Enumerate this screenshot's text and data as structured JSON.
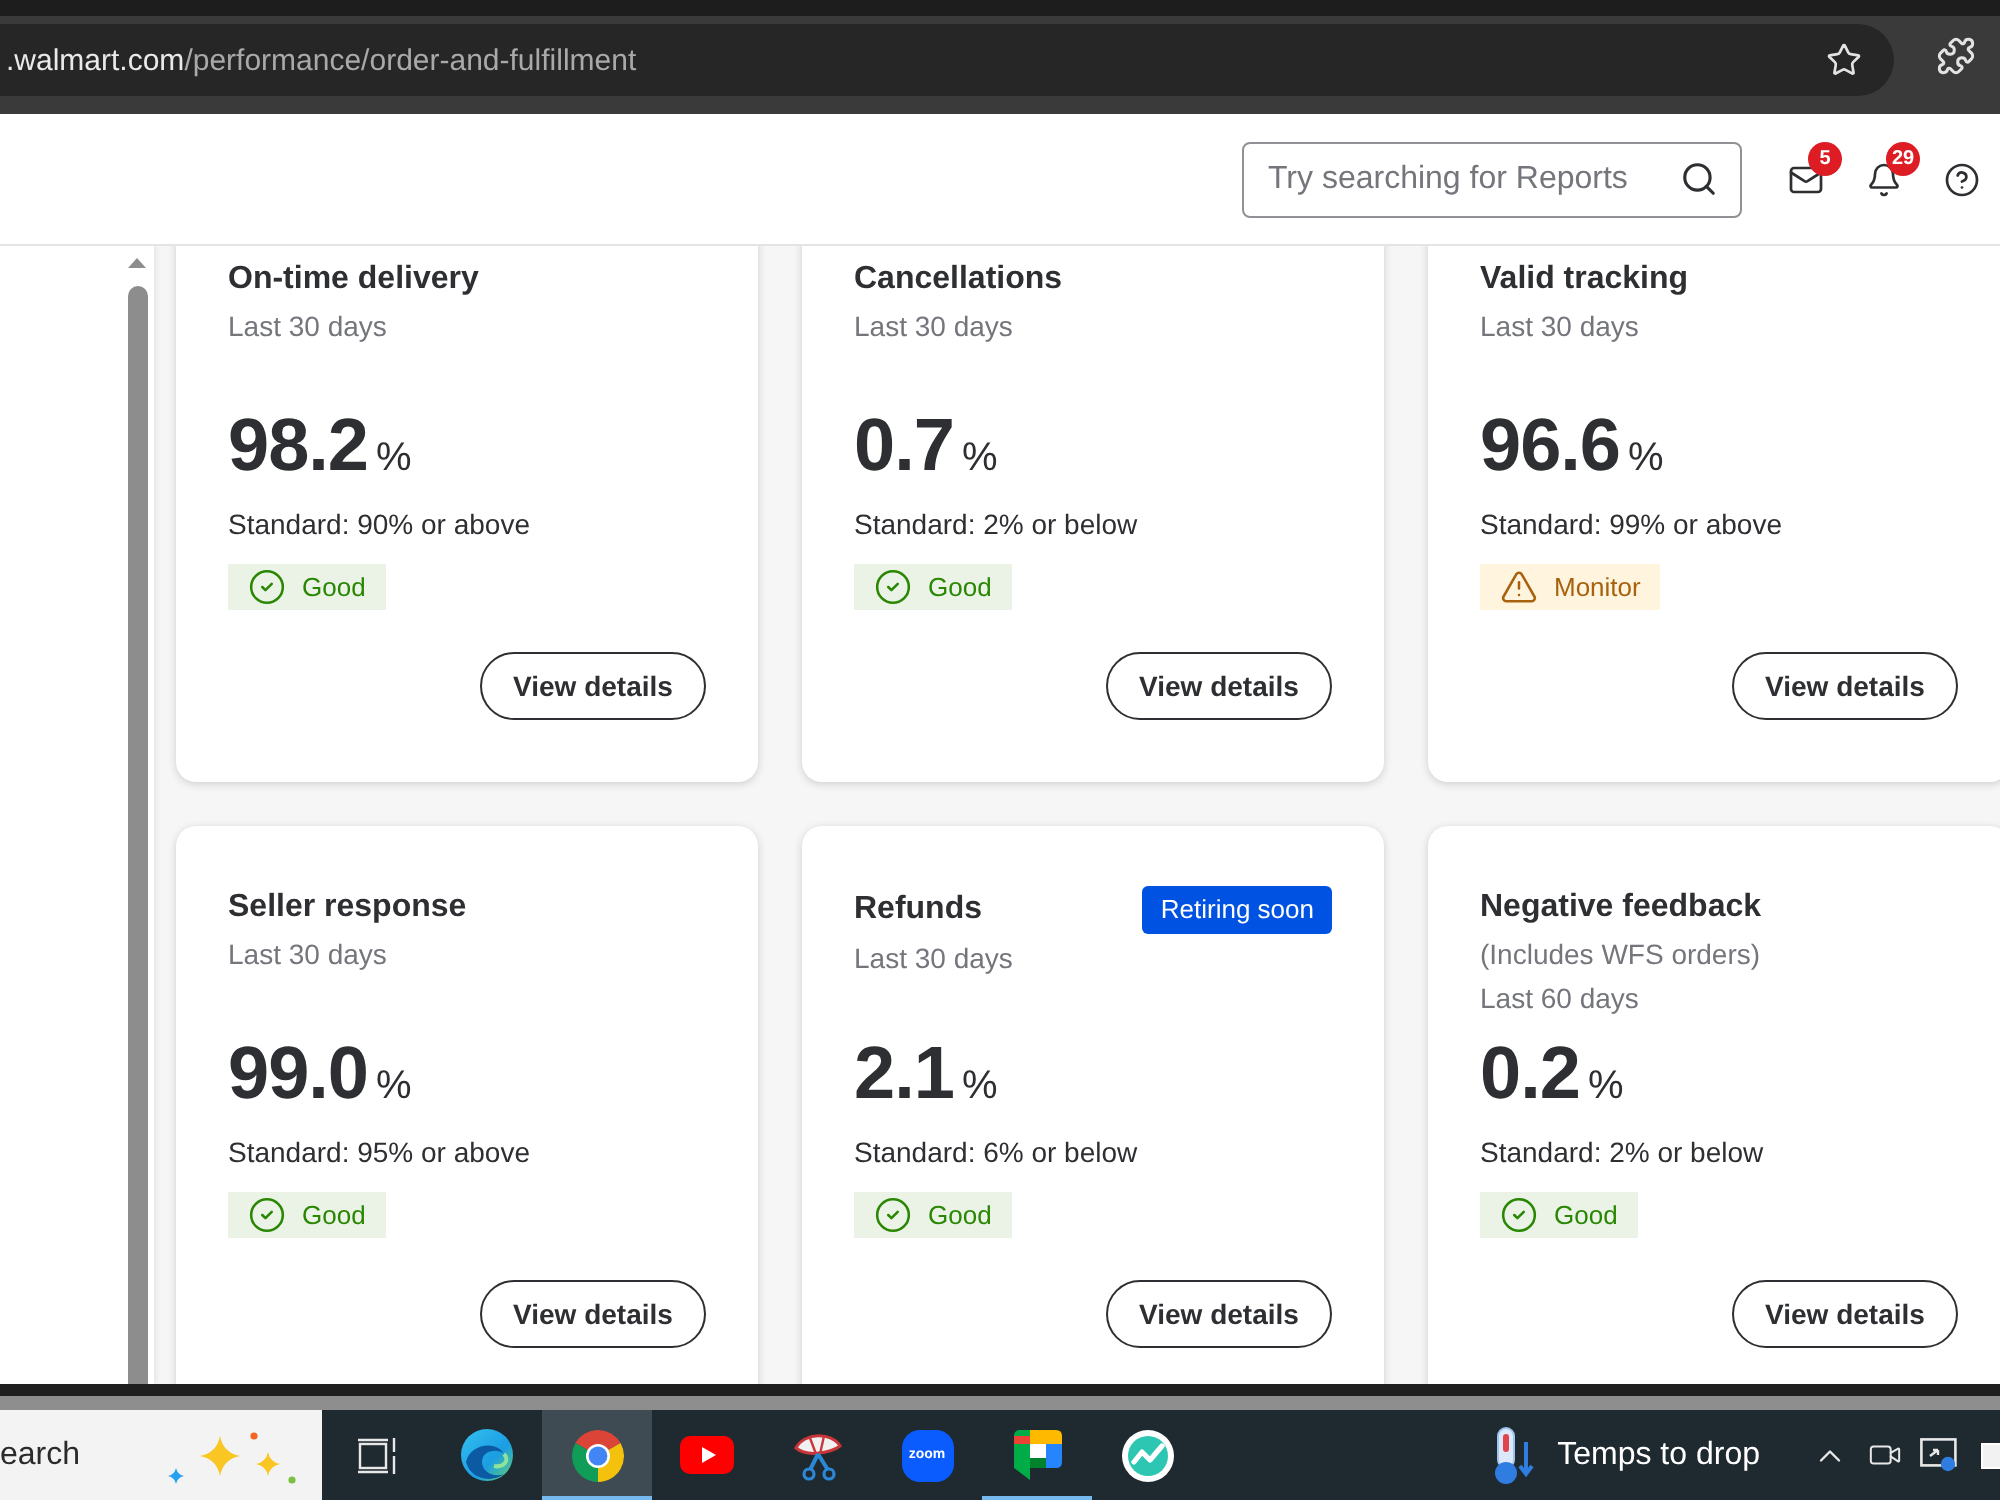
{
  "browser": {
    "url_host": ".walmart.com",
    "url_path": "/performance/order-and-fulfillment"
  },
  "header": {
    "search": {
      "placeholder": "Try searching for Reports"
    },
    "mail_count": "5",
    "alert_count": "29"
  },
  "metrics": [
    {
      "title": "On-time delivery",
      "subtitles": [
        "Last 30 days"
      ],
      "value": "98.2",
      "unit": "%",
      "standard": "Standard: 90% or above",
      "status": {
        "kind": "good",
        "label": "Good"
      },
      "button": "View details"
    },
    {
      "title": "Cancellations",
      "subtitles": [
        "Last 30 days"
      ],
      "value": "0.7",
      "unit": "%",
      "standard": "Standard: 2% or below",
      "status": {
        "kind": "good",
        "label": "Good"
      },
      "button": "View details"
    },
    {
      "title": "Valid tracking",
      "subtitles": [
        "Last 30 days"
      ],
      "value": "96.6",
      "unit": "%",
      "standard": "Standard: 99% or above",
      "status": {
        "kind": "monitor",
        "label": "Monitor"
      },
      "button": "View details"
    },
    {
      "title": "Seller response",
      "subtitles": [
        "Last 30 days"
      ],
      "value": "99.0",
      "unit": "%",
      "standard": "Standard: 95% or above",
      "status": {
        "kind": "good",
        "label": "Good"
      },
      "button": "View details"
    },
    {
      "title": "Refunds",
      "tag": "Retiring soon",
      "subtitles": [
        "Last 30 days"
      ],
      "value": "2.1",
      "unit": "%",
      "standard": "Standard: 6% or below",
      "status": {
        "kind": "good",
        "label": "Good"
      },
      "button": "View details"
    },
    {
      "title": "Negative feedback",
      "subtitles": [
        "(Includes WFS orders)",
        "Last 60 days"
      ],
      "value": "0.2",
      "unit": "%",
      "standard": "Standard: 2% or below",
      "status": {
        "kind": "good",
        "label": "Good"
      },
      "button": "View details"
    }
  ],
  "taskbar": {
    "search": {
      "placeholder": "earch"
    },
    "apps": [
      {
        "kind": "taskview",
        "selected": false,
        "running": false
      },
      {
        "kind": "edge",
        "selected": false,
        "running": false
      },
      {
        "kind": "chrome",
        "selected": true,
        "running": true
      },
      {
        "kind": "youtube",
        "selected": false,
        "running": false
      },
      {
        "kind": "snip",
        "selected": false,
        "running": false
      },
      {
        "kind": "zoom",
        "label": "zoom",
        "selected": false,
        "running": false
      },
      {
        "kind": "chat",
        "selected": false,
        "running": true
      },
      {
        "kind": "pulse",
        "selected": false,
        "running": false
      }
    ],
    "weather": "Temps to drop"
  }
}
